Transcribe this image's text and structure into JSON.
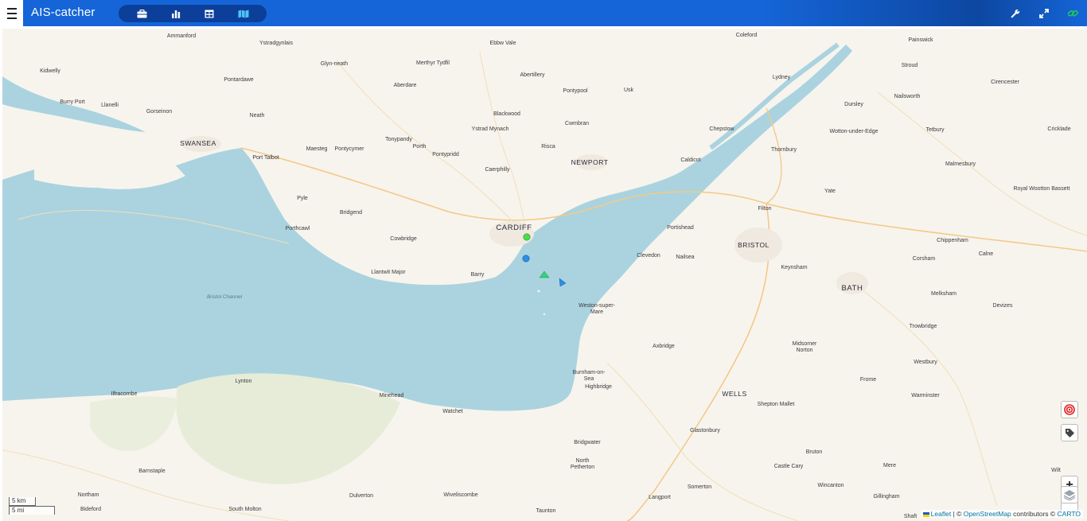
{
  "app": {
    "title": "AIS-catcher"
  },
  "header": {
    "tabs": [
      {
        "name": "dashboard",
        "icon": "briefcase-icon"
      },
      {
        "name": "plots",
        "icon": "bar-chart-icon"
      },
      {
        "name": "ships-table",
        "icon": "table-icon"
      },
      {
        "name": "map",
        "icon": "map-icon",
        "active": true
      }
    ],
    "tools": [
      {
        "name": "settings",
        "icon": "wrench-icon"
      },
      {
        "name": "fullscreen",
        "icon": "expand-icon"
      },
      {
        "name": "connection",
        "icon": "link-icon",
        "color": "#22c55e"
      }
    ]
  },
  "colors": {
    "header": "#1565d8",
    "tab_bar": "#0c3f9a",
    "water": "#aad3df",
    "land": "#f7f4ee",
    "active_tab": "#4fc3f7"
  },
  "map": {
    "places": [
      {
        "label": "Ammanford"
      },
      {
        "label": "Ystradgynlais"
      },
      {
        "label": "Ebbw Vale"
      },
      {
        "label": "Coleford"
      },
      {
        "label": "Painswick"
      },
      {
        "label": "Kidwelly"
      },
      {
        "label": "Glyn-neath"
      },
      {
        "label": "Merthyr Tydfil"
      },
      {
        "label": "Abertillery"
      },
      {
        "label": "Stroud"
      },
      {
        "label": "Pontardawe"
      },
      {
        "label": "Aberdare"
      },
      {
        "label": "Lydney"
      },
      {
        "label": "Cirencester"
      },
      {
        "label": "Burry Port"
      },
      {
        "label": "Llanelli"
      },
      {
        "label": "Pontypool"
      },
      {
        "label": "Usk"
      },
      {
        "label": "Nailsworth"
      },
      {
        "label": "Gorseinon"
      },
      {
        "label": "Neath"
      },
      {
        "label": "Blackwood"
      },
      {
        "label": "Dursley"
      },
      {
        "label": "Cwmbran"
      },
      {
        "label": "Ystrad Mynach"
      },
      {
        "label": "Chepstow"
      },
      {
        "label": "Wotton-under-Edge"
      },
      {
        "label": "Tetbury"
      },
      {
        "label": "Cricklade"
      },
      {
        "label": "SWANSEA"
      },
      {
        "label": "Tonypandy"
      },
      {
        "label": "Porth"
      },
      {
        "label": "Risca"
      },
      {
        "label": "Maesteg"
      },
      {
        "label": "Pontycymer"
      },
      {
        "label": "Pontypridd"
      },
      {
        "label": "Thornbury"
      },
      {
        "label": "Port Talbot"
      },
      {
        "label": "NEWPORT"
      },
      {
        "label": "Caldicot"
      },
      {
        "label": "Malmesbury"
      },
      {
        "label": "Caerphilly"
      },
      {
        "label": "Yate"
      },
      {
        "label": "Royal Wootton Bassett"
      },
      {
        "label": "Pyle"
      },
      {
        "label": "Bridgend"
      },
      {
        "label": "Filton"
      },
      {
        "label": "CARDIFF"
      },
      {
        "label": "Porthcawl"
      },
      {
        "label": "Portishead"
      },
      {
        "label": "Cowbridge"
      },
      {
        "label": "BRISTOL"
      },
      {
        "label": "Chippenham"
      },
      {
        "label": "Clevedon"
      },
      {
        "label": "Nailsea"
      },
      {
        "label": "Calne"
      },
      {
        "label": "Corsham"
      },
      {
        "label": "Keynsham"
      },
      {
        "label": "Llantwit Major"
      },
      {
        "label": "Barry"
      },
      {
        "label": "BATH"
      },
      {
        "label": "Melksham"
      },
      {
        "label": "Devizes"
      },
      {
        "label": "Bristol Channel"
      },
      {
        "label": "Weston-super-Mare"
      },
      {
        "label": "Trowbridge"
      },
      {
        "label": "Axbridge"
      },
      {
        "label": "Midsomer Norton"
      },
      {
        "label": "Westbury"
      },
      {
        "label": "Burnham-on-Sea"
      },
      {
        "label": "Frome"
      },
      {
        "label": "Lynton"
      },
      {
        "label": "Highbridge"
      },
      {
        "label": "Ilfracombe"
      },
      {
        "label": "Minehead"
      },
      {
        "label": "WELLS"
      },
      {
        "label": "Warminster"
      },
      {
        "label": "Watchet"
      },
      {
        "label": "Shepton Mallet"
      },
      {
        "label": "Glastonbury"
      },
      {
        "label": "Bridgwater"
      },
      {
        "label": "Bruton"
      },
      {
        "label": "North Petherton"
      },
      {
        "label": "Barnstaple"
      },
      {
        "label": "Castle Cary"
      },
      {
        "label": "Mere"
      },
      {
        "label": "Wilt"
      },
      {
        "label": "Northam"
      },
      {
        "label": "Dulverton"
      },
      {
        "label": "Wiveliscombe"
      },
      {
        "label": "Somerton"
      },
      {
        "label": "Wincanton"
      },
      {
        "label": "Langport"
      },
      {
        "label": "Gillingham"
      },
      {
        "label": "Bideford"
      },
      {
        "label": "South Molton"
      },
      {
        "label": "Taunton"
      },
      {
        "label": "Shaft"
      }
    ],
    "vessels": [
      {
        "shape": "circle",
        "color": "#4ade4a"
      },
      {
        "shape": "circle",
        "color": "#2b8fe6"
      },
      {
        "shape": "triangle",
        "color": "#34d27a"
      },
      {
        "shape": "triangle",
        "color": "#2b8fe6"
      }
    ],
    "controls": {
      "target_icon": "target-icon",
      "label_icon": "tag-icon",
      "zoom_in": "+",
      "zoom_out": "−",
      "layers_icon": "layers-icon"
    },
    "scale": {
      "km": "5 km",
      "mi": "5 mi"
    },
    "attribution": {
      "leaflet": "Leaflet",
      "sep": " | © ",
      "osm": "OpenStreetMap",
      "contrib": " contributors © ",
      "carto": "CARTO"
    }
  }
}
